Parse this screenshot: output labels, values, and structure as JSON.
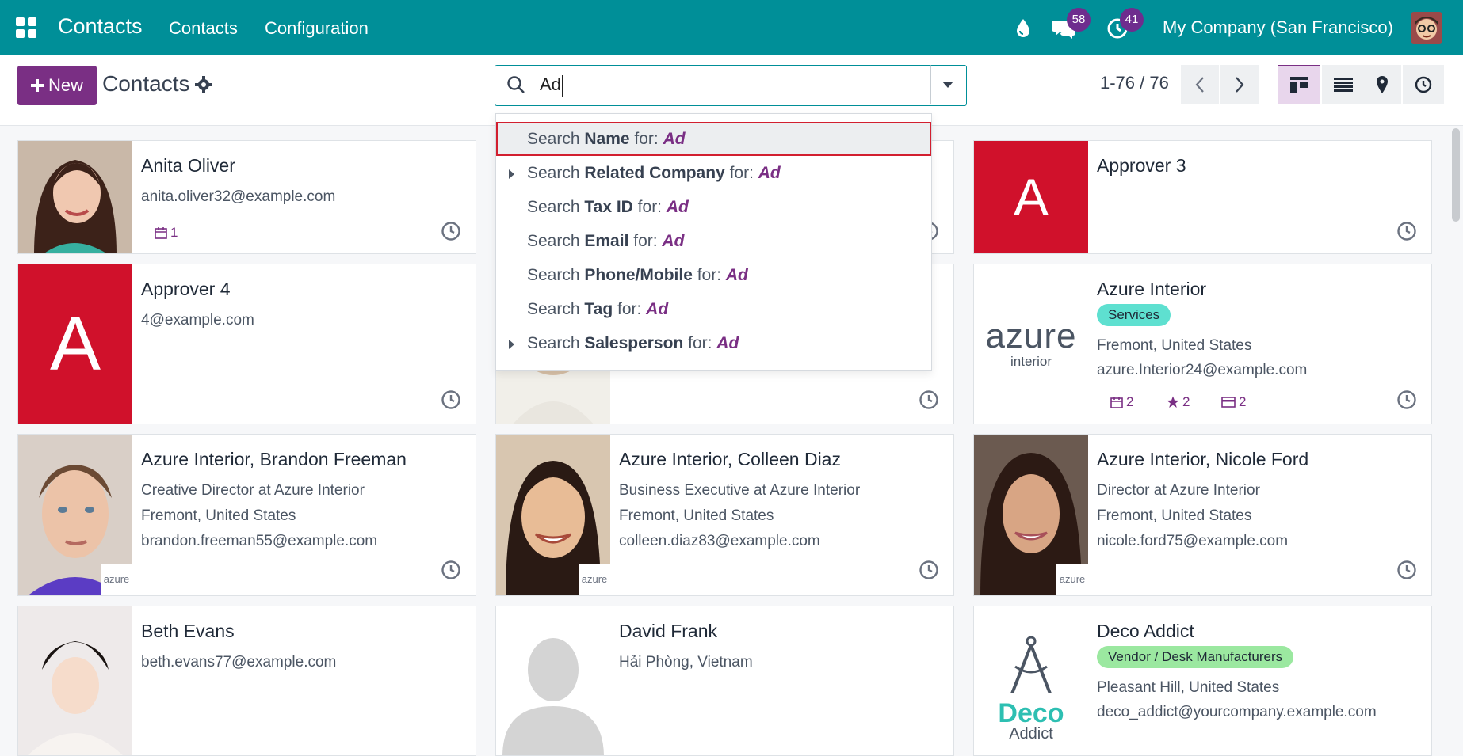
{
  "navbar": {
    "app_title": "Contacts",
    "menu": [
      "Contacts",
      "Configuration"
    ],
    "messages_count": "58",
    "activities_count": "41",
    "company": "My Company (San Francisco)"
  },
  "control": {
    "new_label": "New",
    "title": "Contacts",
    "search_value": "Ad",
    "pager": "1-76 / 76"
  },
  "dropdown": {
    "query": "Ad",
    "items": [
      {
        "prefix": "Search ",
        "field": "Name",
        "suffix": " for: ",
        "expandable": false
      },
      {
        "prefix": "Search ",
        "field": "Related Company",
        "suffix": " for: ",
        "expandable": true
      },
      {
        "prefix": "Search ",
        "field": "Tax ID",
        "suffix": " for: ",
        "expandable": false
      },
      {
        "prefix": "Search ",
        "field": "Email",
        "suffix": " for: ",
        "expandable": false
      },
      {
        "prefix": "Search ",
        "field": "Phone/Mobile",
        "suffix": " for: ",
        "expandable": false
      },
      {
        "prefix": "Search ",
        "field": "Tag",
        "suffix": " for: ",
        "expandable": false
      },
      {
        "prefix": "Search ",
        "field": "Salesperson",
        "suffix": " for: ",
        "expandable": true
      }
    ]
  },
  "cards": {
    "anita": {
      "name": "Anita Oliver",
      "email": "anita.oliver32@example.com",
      "activities": "1"
    },
    "approver3": {
      "name": "Approver 3",
      "initial": "A"
    },
    "approver4": {
      "name": "Approver 4",
      "email": "4@example.com",
      "initial": "A"
    },
    "azure": {
      "name": "Azure Interior",
      "tag": "Services",
      "location": "Fremont, United States",
      "email": "azure.Interior24@example.com",
      "meetings": "2",
      "opportunities": "2",
      "invoices": "2",
      "logo_main": "azure",
      "logo_sub": "interior"
    },
    "brandon": {
      "name": "Azure Interior, Brandon Freeman",
      "job": "Creative Director at Azure Interior",
      "location": "Fremont, United States",
      "email": "brandon.freeman55@example.com"
    },
    "colleen": {
      "name": "Azure Interior, Colleen Diaz",
      "job": "Business Executive at Azure Interior",
      "location": "Fremont, United States",
      "email": "colleen.diaz83@example.com"
    },
    "nicole": {
      "name": "Azure Interior, Nicole Ford",
      "job": "Director at Azure Interior",
      "location": "Fremont, United States",
      "email": "nicole.ford75@example.com"
    },
    "beth": {
      "name": "Beth Evans",
      "email": "beth.evans77@example.com"
    },
    "david": {
      "name": "David Frank",
      "location": "Hải Phòng, Vietnam"
    },
    "deco": {
      "name": "Deco Addict",
      "tag": "Vendor / Desk Manufacturers",
      "location": "Pleasant Hill, United States",
      "email": "deco_addict@yourcompany.example.com",
      "logo_main": "Deco",
      "logo_sub": "Addict"
    },
    "mini_logo": "azure"
  },
  "colors": {
    "navbar": "#008f98",
    "primary": "#7a2f84",
    "avatar_red": "#d0112b",
    "services_tag": "#5ee0d0",
    "vendor_tag": "#9be8a0"
  }
}
